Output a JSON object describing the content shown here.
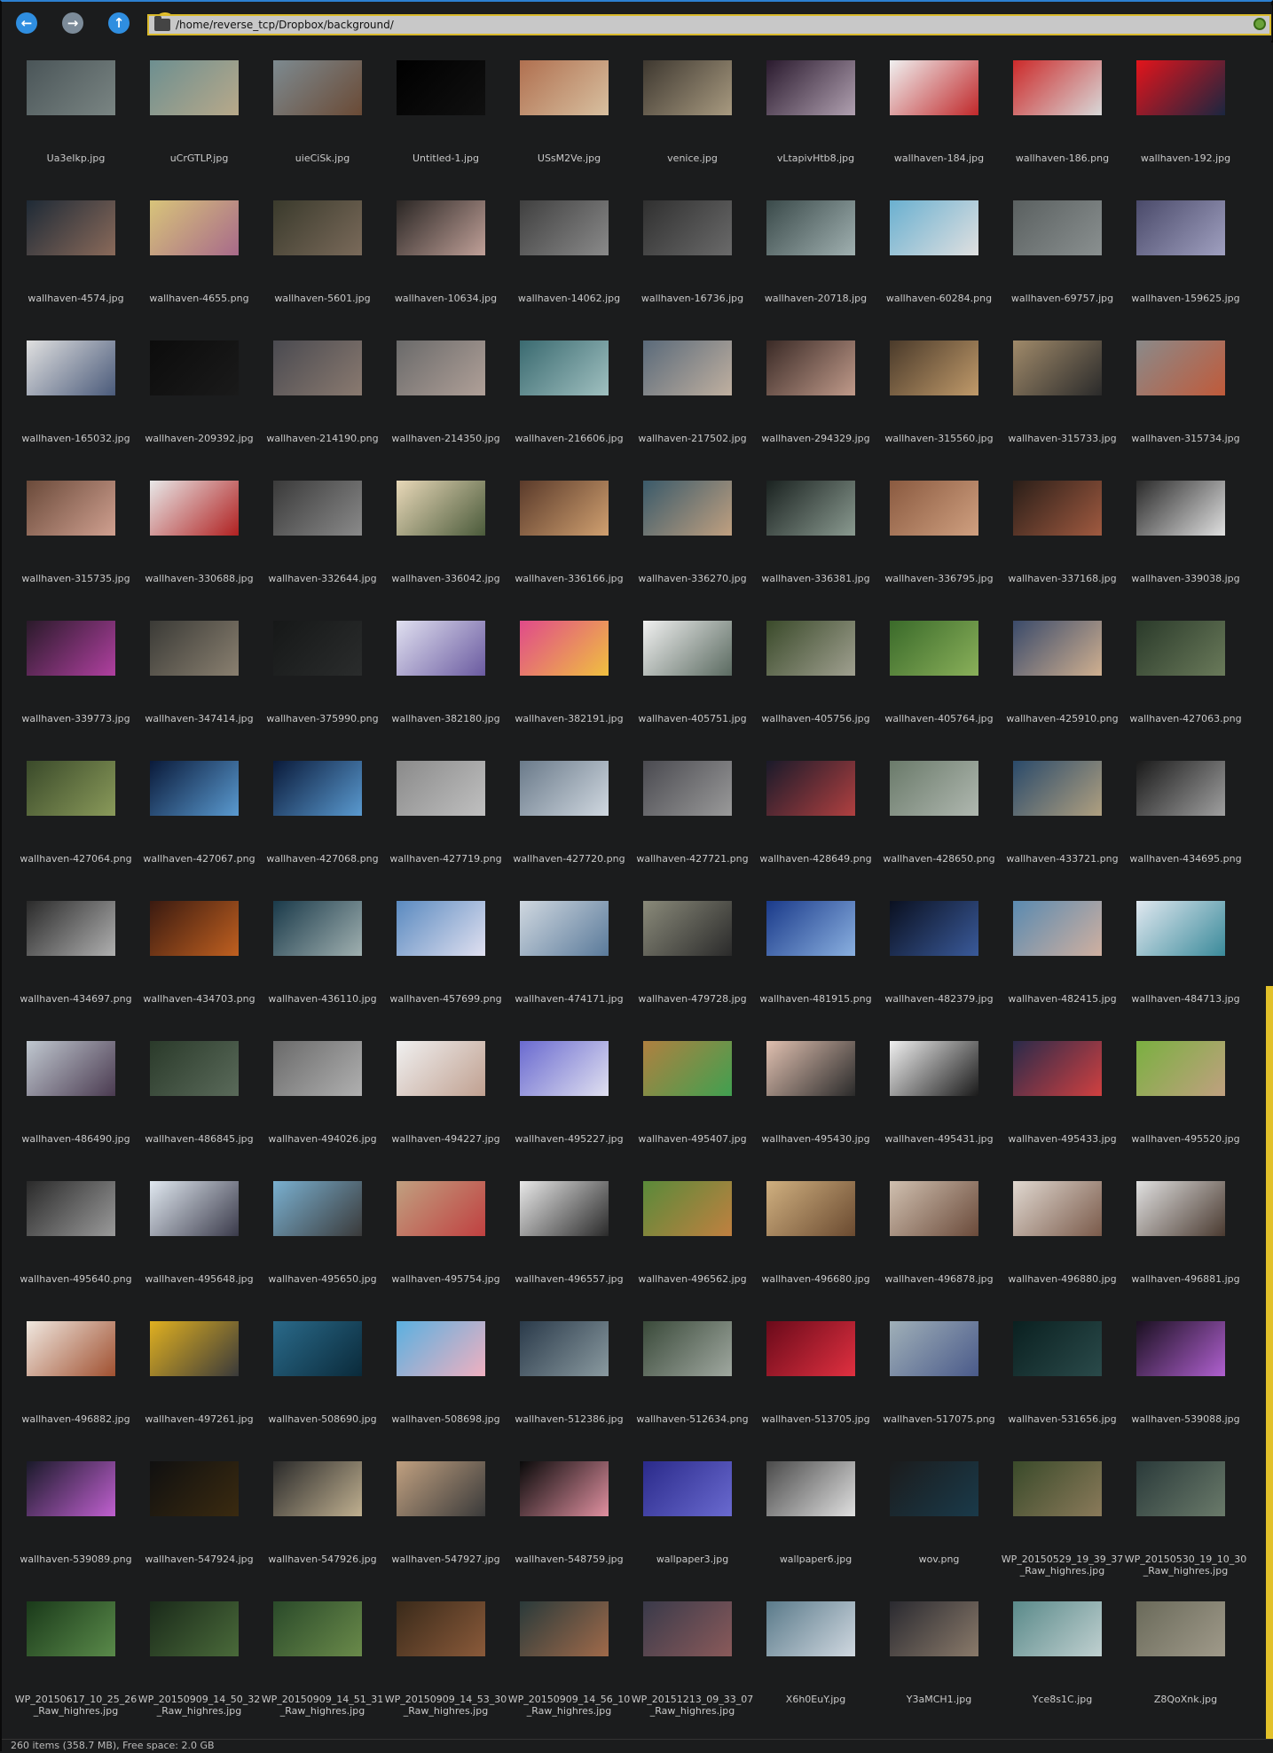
{
  "toolbar": {
    "back_label": "←",
    "forward_label": "→",
    "up_label": "↑",
    "home_label": "⌂",
    "path": "/home/reverse_tcp/Dropbox/background/"
  },
  "files": [
    {
      "name": "Ua3eIkp.jpg",
      "colors": [
        "#4a5558",
        "#7a8583"
      ]
    },
    {
      "name": "uCrGTLP.jpg",
      "colors": [
        "#6d8f90",
        "#b8a98a"
      ]
    },
    {
      "name": "uieCiSk.jpg",
      "colors": [
        "#7d8a90",
        "#6a4a35"
      ]
    },
    {
      "name": "Untitled-1.jpg",
      "colors": [
        "#000000",
        "#101010"
      ]
    },
    {
      "name": "USsM2Ve.jpg",
      "colors": [
        "#b07050",
        "#d8c0a0"
      ]
    },
    {
      "name": "venice.jpg",
      "colors": [
        "#3e3830",
        "#a89a80"
      ]
    },
    {
      "name": "vLtapivHtb8.jpg",
      "colors": [
        "#2a1a2e",
        "#b0a0b0"
      ]
    },
    {
      "name": "wallhaven-184.jpg",
      "colors": [
        "#f0f0f0",
        "#c0282a"
      ]
    },
    {
      "name": "wallhaven-186.png",
      "colors": [
        "#cc2a2a",
        "#d8d8d8"
      ]
    },
    {
      "name": "wallhaven-192.jpg",
      "colors": [
        "#e3141b",
        "#1a2640"
      ]
    },
    {
      "name": "wallhaven-4574.jpg",
      "colors": [
        "#1e2a36",
        "#8a6a5a"
      ]
    },
    {
      "name": "wallhaven-4655.png",
      "colors": [
        "#d8c47a",
        "#a86a8a"
      ]
    },
    {
      "name": "wallhaven-5601.jpg",
      "colors": [
        "#3a3a2c",
        "#7a6a5a"
      ]
    },
    {
      "name": "wallhaven-10634.jpg",
      "colors": [
        "#2a2624",
        "#c0a098"
      ]
    },
    {
      "name": "wallhaven-14062.jpg",
      "colors": [
        "#404040",
        "#8a8a8a"
      ]
    },
    {
      "name": "wallhaven-16736.jpg",
      "colors": [
        "#303030",
        "#6a6a6a"
      ]
    },
    {
      "name": "wallhaven-20718.jpg",
      "colors": [
        "#3a4a4a",
        "#a0b0b0"
      ]
    },
    {
      "name": "wallhaven-60284.png",
      "colors": [
        "#6ab0d0",
        "#e0e0e0"
      ]
    },
    {
      "name": "wallhaven-69757.jpg",
      "colors": [
        "#5a6060",
        "#8a9090"
      ]
    },
    {
      "name": "wallhaven-159625.jpg",
      "colors": [
        "#4a4a6a",
        "#a0a0c0"
      ]
    },
    {
      "name": "wallhaven-165032.jpg",
      "colors": [
        "#e0e0e0",
        "#4a5a7a"
      ]
    },
    {
      "name": "wallhaven-209392.jpg",
      "colors": [
        "#0c0c0c",
        "#1a1a1a"
      ]
    },
    {
      "name": "wallhaven-214190.png",
      "colors": [
        "#4a4a50",
        "#8a7a70"
      ]
    },
    {
      "name": "wallhaven-214350.jpg",
      "colors": [
        "#6a6a6a",
        "#b0a098"
      ]
    },
    {
      "name": "wallhaven-216606.jpg",
      "colors": [
        "#3a6a70",
        "#a0c0c0"
      ]
    },
    {
      "name": "wallhaven-217502.jpg",
      "colors": [
        "#5a6a7a",
        "#c0b0a0"
      ]
    },
    {
      "name": "wallhaven-294329.jpg",
      "colors": [
        "#3a2a26",
        "#c09a8a"
      ]
    },
    {
      "name": "wallhaven-315560.jpg",
      "colors": [
        "#4a3a2a",
        "#c09a6a"
      ]
    },
    {
      "name": "wallhaven-315733.jpg",
      "colors": [
        "#a08a6a",
        "#2a2a2a"
      ]
    },
    {
      "name": "wallhaven-315734.jpg",
      "colors": [
        "#8a8a8a",
        "#c05a3a"
      ]
    },
    {
      "name": "wallhaven-315735.jpg",
      "colors": [
        "#6a4a3a",
        "#d0a090"
      ]
    },
    {
      "name": "wallhaven-330688.jpg",
      "colors": [
        "#e8e8e8",
        "#b02020"
      ]
    },
    {
      "name": "wallhaven-332644.jpg",
      "colors": [
        "#3a3a3a",
        "#8a8a8a"
      ]
    },
    {
      "name": "wallhaven-336042.jpg",
      "colors": [
        "#e8d8b8",
        "#4a5a3a"
      ]
    },
    {
      "name": "wallhaven-336166.jpg",
      "colors": [
        "#5a3a2a",
        "#d0a070"
      ]
    },
    {
      "name": "wallhaven-336270.jpg",
      "colors": [
        "#3a5a6a",
        "#c0a080"
      ]
    },
    {
      "name": "wallhaven-336381.jpg",
      "colors": [
        "#1a2220",
        "#8a9a90"
      ]
    },
    {
      "name": "wallhaven-336795.jpg",
      "colors": [
        "#8a5a40",
        "#d0a080"
      ]
    },
    {
      "name": "wallhaven-337168.jpg",
      "colors": [
        "#2a1e18",
        "#a05a40"
      ]
    },
    {
      "name": "wallhaven-339038.jpg",
      "colors": [
        "#2a2a2a",
        "#e0e0e0"
      ]
    },
    {
      "name": "wallhaven-339773.jpg",
      "colors": [
        "#2a1a2a",
        "#b040a0"
      ]
    },
    {
      "name": "wallhaven-347414.jpg",
      "colors": [
        "#3a3a36",
        "#8a8070"
      ]
    },
    {
      "name": "wallhaven-375990.png",
      "colors": [
        "#161818",
        "#2a2c2c"
      ]
    },
    {
      "name": "wallhaven-382180.jpg",
      "colors": [
        "#e0e0f0",
        "#6a5aa0"
      ]
    },
    {
      "name": "wallhaven-382191.jpg",
      "colors": [
        "#e04a8a",
        "#f0c040"
      ]
    },
    {
      "name": "wallhaven-405751.jpg",
      "colors": [
        "#f0f0f0",
        "#5a6a60"
      ]
    },
    {
      "name": "wallhaven-405756.jpg",
      "colors": [
        "#3a4a2a",
        "#a0a090"
      ]
    },
    {
      "name": "wallhaven-405764.jpg",
      "colors": [
        "#3a6a2a",
        "#8ab05a"
      ]
    },
    {
      "name": "wallhaven-425910.png",
      "colors": [
        "#3a4a6a",
        "#d0b090"
      ]
    },
    {
      "name": "wallhaven-427063.png",
      "colors": [
        "#2a3a2a",
        "#6a7a5a"
      ]
    },
    {
      "name": "wallhaven-427064.png",
      "colors": [
        "#3a4a2a",
        "#8a9a5a"
      ]
    },
    {
      "name": "wallhaven-427067.png",
      "colors": [
        "#0a1a3a",
        "#5a9ad0"
      ]
    },
    {
      "name": "wallhaven-427068.png",
      "colors": [
        "#0a1a3a",
        "#5a9ad0"
      ]
    },
    {
      "name": "wallhaven-427719.png",
      "colors": [
        "#8a8a8a",
        "#c0c0c0"
      ]
    },
    {
      "name": "wallhaven-427720.png",
      "colors": [
        "#6a7a8a",
        "#d0d8e0"
      ]
    },
    {
      "name": "wallhaven-427721.png",
      "colors": [
        "#4a4a50",
        "#9a9a9a"
      ]
    },
    {
      "name": "wallhaven-428649.png",
      "colors": [
        "#1a1a2a",
        "#b04040"
      ]
    },
    {
      "name": "wallhaven-428650.png",
      "colors": [
        "#6a7a6a",
        "#b0b8b0"
      ]
    },
    {
      "name": "wallhaven-433721.png",
      "colors": [
        "#2a4a6a",
        "#b0a080"
      ]
    },
    {
      "name": "wallhaven-434695.png",
      "colors": [
        "#1a1a1a",
        "#a0a0a0"
      ]
    },
    {
      "name": "wallhaven-434697.png",
      "colors": [
        "#2a2a2a",
        "#b0b0b0"
      ]
    },
    {
      "name": "wallhaven-434703.png",
      "colors": [
        "#3a1a10",
        "#c06020"
      ]
    },
    {
      "name": "wallhaven-436110.jpg",
      "colors": [
        "#1a3a4a",
        "#a0b0b0"
      ]
    },
    {
      "name": "wallhaven-457699.png",
      "colors": [
        "#5a8ac0",
        "#e0e0f0"
      ]
    },
    {
      "name": "wallhaven-474171.jpg",
      "colors": [
        "#d0d8e0",
        "#5a7a9a"
      ]
    },
    {
      "name": "wallhaven-479728.jpg",
      "colors": [
        "#8a8a7a",
        "#2a2a2a"
      ]
    },
    {
      "name": "wallhaven-481915.png",
      "colors": [
        "#1a3a8a",
        "#8ab0e0"
      ]
    },
    {
      "name": "wallhaven-482379.jpg",
      "colors": [
        "#0a1020",
        "#3a5a9a"
      ]
    },
    {
      "name": "wallhaven-482415.jpg",
      "colors": [
        "#5a8ab0",
        "#d0b0a0"
      ]
    },
    {
      "name": "wallhaven-484713.jpg",
      "colors": [
        "#e0e8f0",
        "#3a8a9a"
      ]
    },
    {
      "name": "wallhaven-486490.jpg",
      "colors": [
        "#c0c8d0",
        "#4a3a50"
      ]
    },
    {
      "name": "wallhaven-486845.jpg",
      "colors": [
        "#2a3a2a",
        "#5a6a5a"
      ]
    },
    {
      "name": "wallhaven-494026.jpg",
      "colors": [
        "#6a6a6a",
        "#b0b0b0"
      ]
    },
    {
      "name": "wallhaven-494227.jpg",
      "colors": [
        "#f0f0f0",
        "#c0a090"
      ]
    },
    {
      "name": "wallhaven-495227.jpg",
      "colors": [
        "#6a6ad0",
        "#e0e0f0"
      ]
    },
    {
      "name": "wallhaven-495407.jpg",
      "colors": [
        "#b08040",
        "#40a050"
      ]
    },
    {
      "name": "wallhaven-495430.jpg",
      "colors": [
        "#e0c0b0",
        "#2a2a2a"
      ]
    },
    {
      "name": "wallhaven-495431.jpg",
      "colors": [
        "#f0f0f0",
        "#1a1a1a"
      ]
    },
    {
      "name": "wallhaven-495433.jpg",
      "colors": [
        "#2a2a4a",
        "#d04040"
      ]
    },
    {
      "name": "wallhaven-495520.jpg",
      "colors": [
        "#7ab040",
        "#c0a080"
      ]
    },
    {
      "name": "wallhaven-495640.png",
      "colors": [
        "#2a2a2a",
        "#9a9a9a"
      ]
    },
    {
      "name": "wallhaven-495648.jpg",
      "colors": [
        "#e0e8f0",
        "#3a3a4a"
      ]
    },
    {
      "name": "wallhaven-495650.jpg",
      "colors": [
        "#7ab0d0",
        "#3a3a3a"
      ]
    },
    {
      "name": "wallhaven-495754.jpg",
      "colors": [
        "#c0a080",
        "#c04040"
      ]
    },
    {
      "name": "wallhaven-496557.jpg",
      "colors": [
        "#e8e8e8",
        "#2a2a2a"
      ]
    },
    {
      "name": "wallhaven-496562.jpg",
      "colors": [
        "#5a8a3a",
        "#c08040"
      ]
    },
    {
      "name": "wallhaven-496680.jpg",
      "colors": [
        "#d0b080",
        "#6a4a30"
      ]
    },
    {
      "name": "wallhaven-496878.jpg",
      "colors": [
        "#d0c0b0",
        "#6a4a3a"
      ]
    },
    {
      "name": "wallhaven-496880.jpg",
      "colors": [
        "#e0d8d0",
        "#7a5a4a"
      ]
    },
    {
      "name": "wallhaven-496881.jpg",
      "colors": [
        "#e0e0e0",
        "#4a3a30"
      ]
    },
    {
      "name": "wallhaven-496882.jpg",
      "colors": [
        "#f0e8e0",
        "#a05030"
      ]
    },
    {
      "name": "wallhaven-497261.jpg",
      "colors": [
        "#e0b020",
        "#3a3a3a"
      ]
    },
    {
      "name": "wallhaven-508690.jpg",
      "colors": [
        "#2a6a8a",
        "#0a2a3a"
      ]
    },
    {
      "name": "wallhaven-508698.jpg",
      "colors": [
        "#5ab0e0",
        "#f0b0c0"
      ]
    },
    {
      "name": "wallhaven-512386.jpg",
      "colors": [
        "#2a3a4a",
        "#8a9aa0"
      ]
    },
    {
      "name": "wallhaven-512634.png",
      "colors": [
        "#3a4a3a",
        "#a0a8a0"
      ]
    },
    {
      "name": "wallhaven-513705.jpg",
      "colors": [
        "#6a0a1a",
        "#e03040"
      ]
    },
    {
      "name": "wallhaven-517075.png",
      "colors": [
        "#a0b0b8",
        "#4a5a8a"
      ]
    },
    {
      "name": "wallhaven-531656.jpg",
      "colors": [
        "#0a2020",
        "#2a4a4a"
      ]
    },
    {
      "name": "wallhaven-539088.jpg",
      "colors": [
        "#1a1020",
        "#b060d0"
      ]
    },
    {
      "name": "wallhaven-539089.png",
      "colors": [
        "#1a1a2a",
        "#c060d0"
      ]
    },
    {
      "name": "wallhaven-547924.jpg",
      "colors": [
        "#101010",
        "#3a2a10"
      ]
    },
    {
      "name": "wallhaven-547926.jpg",
      "colors": [
        "#2a2a2a",
        "#c0b090"
      ]
    },
    {
      "name": "wallhaven-547927.jpg",
      "colors": [
        "#c0a080",
        "#3a3a3a"
      ]
    },
    {
      "name": "wallhaven-548759.jpg",
      "colors": [
        "#0a0a0a",
        "#e090a0"
      ]
    },
    {
      "name": "wallpaper3.jpg",
      "colors": [
        "#2a2a8a",
        "#6a6ad0"
      ]
    },
    {
      "name": "wallpaper6.jpg",
      "colors": [
        "#4a4a4a",
        "#e0e0e0"
      ]
    },
    {
      "name": "wov.png",
      "colors": [
        "#1b1c1d",
        "#1a3a4a"
      ]
    },
    {
      "name": "WP_20150529_19_39_37_Raw_highres.jpg",
      "colors": [
        "#3a4a2a",
        "#8a7a5a"
      ]
    },
    {
      "name": "WP_20150530_19_10_30_Raw_highres.jpg",
      "colors": [
        "#2a3a3a",
        "#6a7a6a"
      ]
    },
    {
      "name": "WP_20150617_10_25_26_Raw_highres.jpg",
      "colors": [
        "#1a3a1a",
        "#5a8a4a"
      ]
    },
    {
      "name": "WP_20150909_14_50_32_Raw_highres.jpg",
      "colors": [
        "#1a2a1a",
        "#4a6a3a"
      ]
    },
    {
      "name": "WP_20150909_14_51_31_Raw_highres.jpg",
      "colors": [
        "#2a4a2a",
        "#6a8a4a"
      ]
    },
    {
      "name": "WP_20150909_14_53_30_Raw_highres.jpg",
      "colors": [
        "#3a2a1a",
        "#8a5a3a"
      ]
    },
    {
      "name": "WP_20150909_14_56_10_Raw_highres.jpg",
      "colors": [
        "#2a3a3a",
        "#a06a4a"
      ]
    },
    {
      "name": "WP_20151213_09_33_07_Raw_highres.jpg",
      "colors": [
        "#3a3a4a",
        "#8a5a5a"
      ]
    },
    {
      "name": "X6h0EuY.jpg",
      "colors": [
        "#5a7a8a",
        "#d0d8e0"
      ]
    },
    {
      "name": "Y3aMCH1.jpg",
      "colors": [
        "#2a2a30",
        "#8a7a6a"
      ]
    },
    {
      "name": "Yce8s1C.jpg",
      "colors": [
        "#5a8a8a",
        "#c0d0d0"
      ]
    },
    {
      "name": "Z8QoXnk.jpg",
      "colors": [
        "#6a6a5a",
        "#a09a8a"
      ]
    }
  ],
  "statusbar": {
    "text": "260 items (358.7 MB), Free space: 2.0 GB"
  }
}
